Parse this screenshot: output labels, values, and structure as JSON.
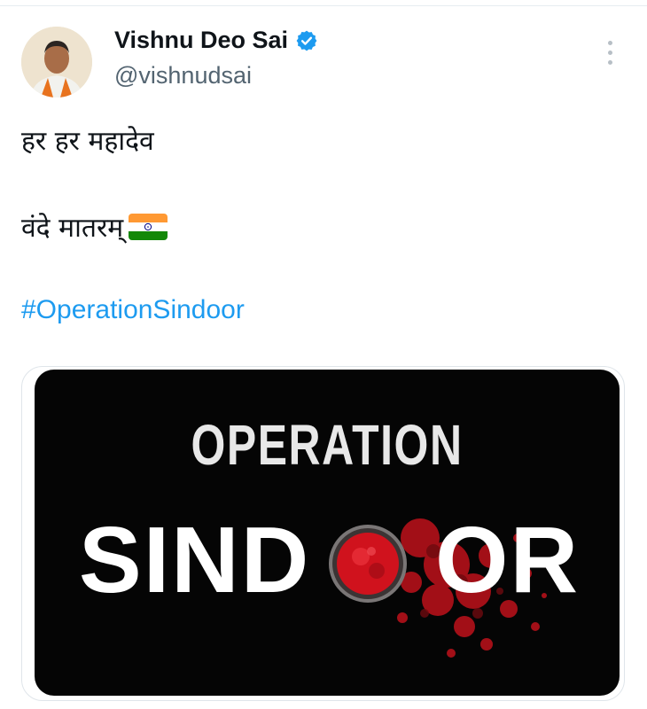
{
  "tweet": {
    "author_name": "Vishnu Deo Sai",
    "handle": "@vishnudsai",
    "verified_icon": "verified-badge-icon",
    "line1": "हर हर महादेव",
    "line2": "वंदे मातरम्",
    "flag_icon": "india-flag-icon",
    "hashtag": "#OperationSindoor"
  },
  "media": {
    "title_top": "OPERATION",
    "title_left": "SIND",
    "title_right": "OR"
  },
  "colors": {
    "link": "#1d9bf0",
    "verified": "#1d9bf0",
    "sindoor_red": "#c8141c"
  }
}
